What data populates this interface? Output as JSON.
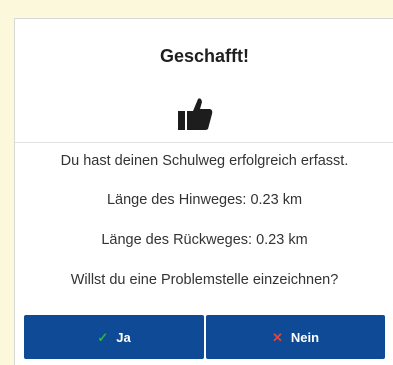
{
  "dialog": {
    "title": "Geschafft!",
    "icon": "thumbs-up-icon",
    "message": "Du hast deinen Schulweg erfolgreich erfasst.",
    "distance_outbound": "Länge des Hinweges: 0.23 km",
    "distance_return": "Länge des Rückweges: 0.23 km",
    "question": "Willst du eine Problemstelle einzeichnen?"
  },
  "buttons": {
    "yes_icon": "✓",
    "yes_label": "Ja",
    "no_icon": "✕",
    "no_label": "Nein"
  },
  "colors": {
    "button_bg": "#0e4a96",
    "check": "#2fb14a",
    "cross": "#e8433a"
  }
}
